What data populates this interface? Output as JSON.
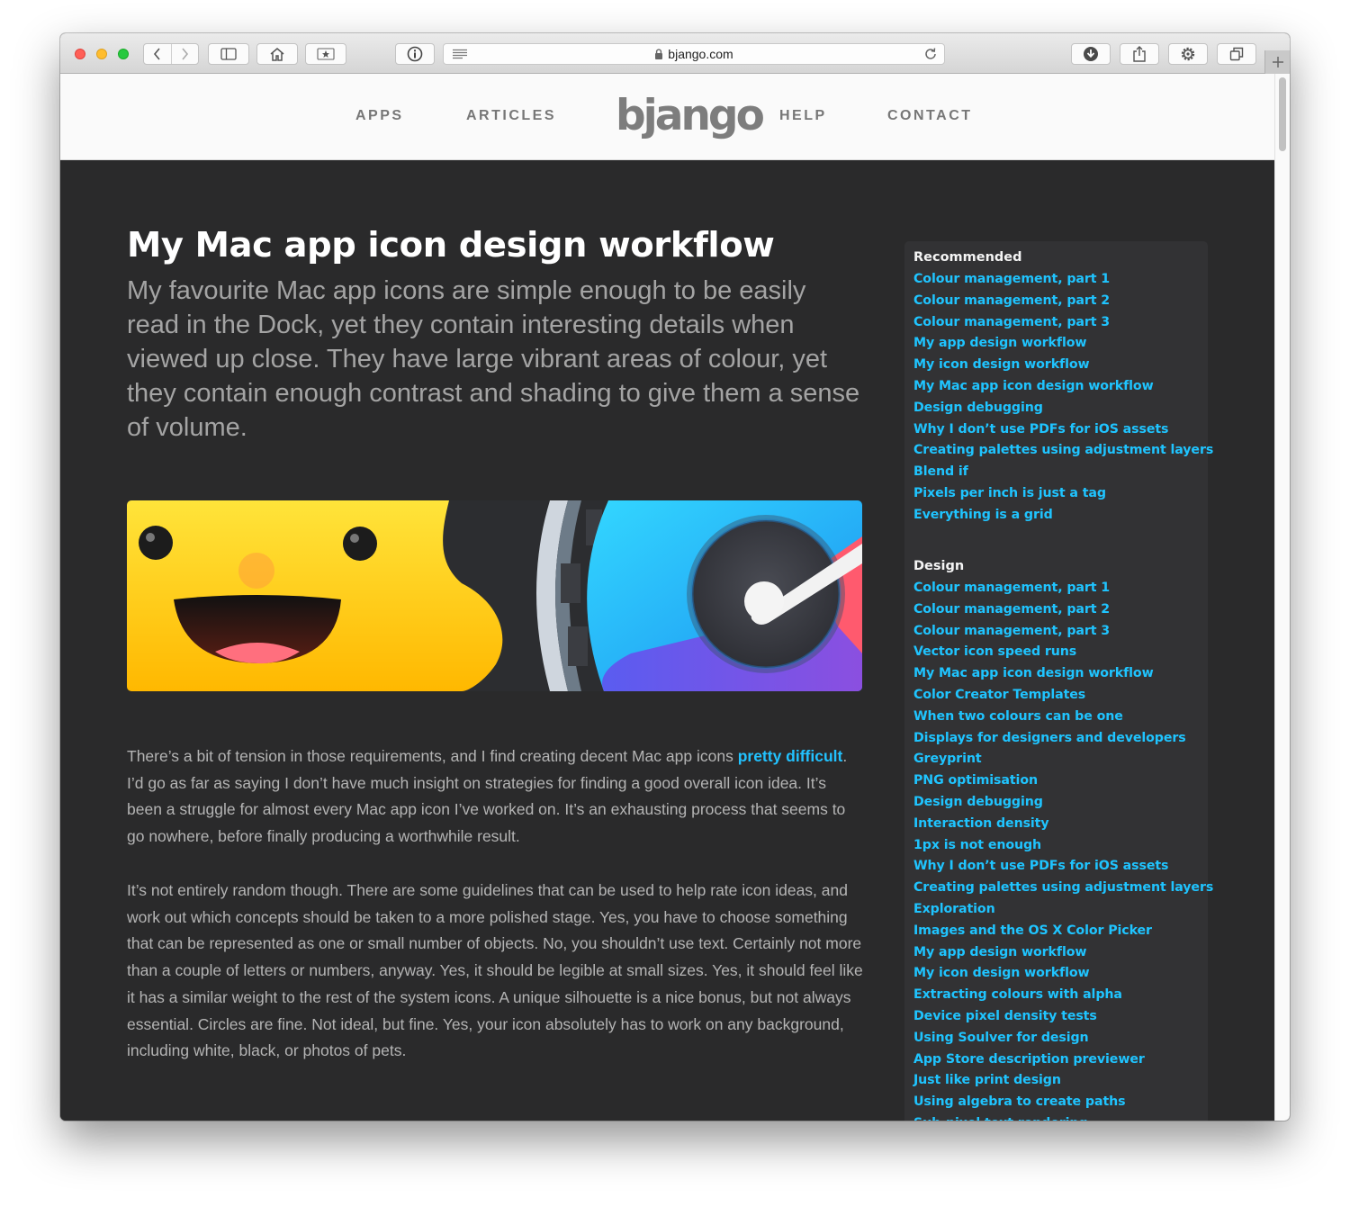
{
  "browser": {
    "url": "bjango.com",
    "icons": {
      "back": "chevron-left-icon",
      "forward": "chevron-right-icon",
      "sidebar": "sidebar-icon",
      "home": "home-icon",
      "bookmark": "star-bookmark-icon",
      "info": "info-icon",
      "reader": "reader-icon",
      "lock": "lock-icon",
      "reload": "reload-icon",
      "download": "download-icon",
      "share": "share-icon",
      "settings": "gear-icon",
      "tabs": "tabs-icon",
      "new_tab": "plus-icon"
    }
  },
  "site": {
    "logo": "bjango",
    "nav": [
      "APPS",
      "ARTICLES",
      "HELP",
      "CONTACT"
    ]
  },
  "article": {
    "title": "My Mac app icon design workflow",
    "lede": "My favourite Mac app icons are simple enough to be easily read in the Dock, yet they contain interesting details when viewed up close. They have large vibrant areas of colour, yet they contain enough contrast and shading to give them a sense of volume.",
    "p1_before": "There’s a bit of tension in those requirements, and I find creating decent Mac app icons ",
    "p1_link": "pretty difficult",
    "p1_after": ". I’d go as far as saying I don’t have much insight on strategies for finding a good overall icon idea. It’s been a struggle for almost every Mac app icon I’ve worked on. It’s an exhausting process that seems to go nowhere, before finally producing a worthwhile result.",
    "p2": "It’s not entirely random though. There are some guidelines that can be used to help rate icon ideas, and work out which concepts should be taken to a more polished stage. Yes, you have to choose something that can be represented as one or small number of objects. No, you shouldn’t use text. Certainly not more than a couple of letters or numbers, anyway. Yes, it should be legible at small sizes. Yes, it should feel like it has a similar weight to the rest of the system icons. A unique silhouette is a nice bonus, but not always essential. Circles are fine. Not ideal, but fine. Yes, your icon absolutely has to work on any background, including white, black, or photos of pets."
  },
  "sidebar": {
    "recommended_heading": "Recommended",
    "recommended": [
      "Colour management, part 1",
      "Colour management, part 2",
      "Colour management, part 3",
      "My app design workflow",
      "My icon design workflow",
      "My Mac app icon design workflow",
      "Design debugging",
      "Why I don’t use PDFs for iOS assets",
      "Creating palettes using adjustment layers",
      "Blend if",
      "Pixels per inch is just a tag",
      "Everything is a grid"
    ],
    "design_heading": "Design",
    "design": [
      "Colour management, part 1",
      "Colour management, part 2",
      "Colour management, part 3",
      "Vector icon speed runs",
      "My Mac app icon design workflow",
      "Color Creator Templates",
      "When two colours can be one",
      "Displays for designers and developers",
      "Greyprint",
      "PNG optimisation",
      "Design debugging",
      "Interaction density",
      "1px is not enough",
      "Why I don’t use PDFs for iOS assets",
      "Creating palettes using adjustment layers",
      "Exploration",
      "Images and the OS X Color Picker",
      "My app design workflow",
      "My icon design workflow",
      "Extracting colours with alpha",
      "Device pixel density tests",
      "Using Soulver for design",
      "App Store description previewer",
      "Just like print design",
      "Using algebra to create paths",
      "Sub-pixel text rendering"
    ]
  },
  "colors": {
    "link": "#22c2ff",
    "page_background": "#2a2a2b",
    "sidebar_background": "#323234"
  }
}
